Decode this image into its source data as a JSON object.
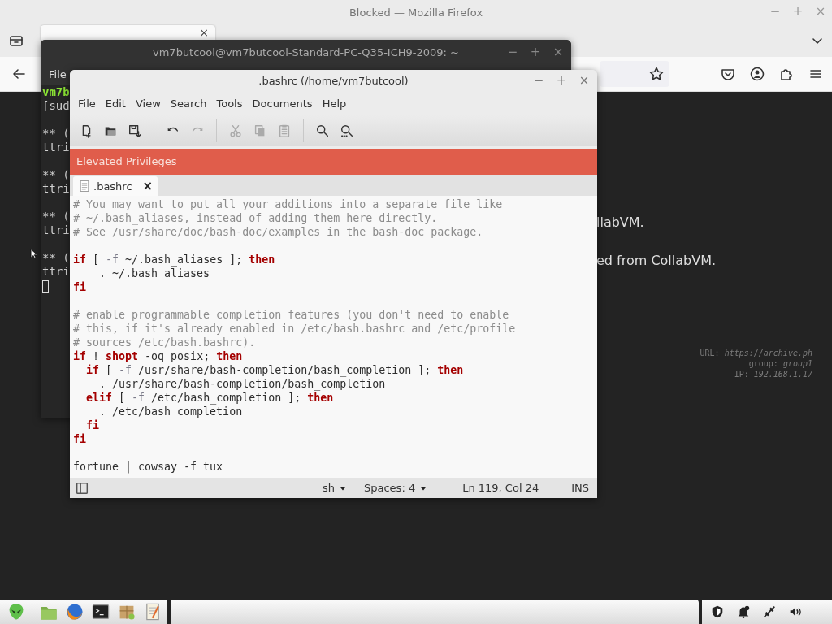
{
  "firefox": {
    "title": "Blocked — Mozilla Firefox",
    "window_controls": [
      "−",
      "+",
      "×"
    ],
    "tab": {
      "close": "×",
      "selected": true
    },
    "page_lines": [
      "llabVM.",
      "ed from CollabVM."
    ],
    "info_lines": [
      "URL: *https://archive.ph*",
      "group: *group1*",
      "IP: *192.168.1.17*"
    ]
  },
  "terminal": {
    "title": "vm7butcool@vm7butcool-Standard-PC-Q35-ICH9-2009: ~",
    "window_controls": [
      "−",
      "+",
      "×"
    ],
    "menu": [
      "File"
    ],
    "lines": [
      {
        "kind": "prompt",
        "text": "vm7b"
      },
      {
        "kind": "text",
        "text": "[sud"
      },
      {
        "kind": "blank"
      },
      {
        "kind": "text",
        "text": "** ("
      },
      {
        "kind": "text",
        "text": "ttri"
      },
      {
        "kind": "blank"
      },
      {
        "kind": "text",
        "text": "** ("
      },
      {
        "kind": "text",
        "text": "ttri"
      },
      {
        "kind": "blank"
      },
      {
        "kind": "text",
        "text": "** ("
      },
      {
        "kind": "text",
        "text": "ttri"
      },
      {
        "kind": "blank"
      },
      {
        "kind": "text",
        "text": "** ("
      },
      {
        "kind": "text",
        "text": "ttri"
      },
      {
        "kind": "cursor"
      }
    ]
  },
  "editor": {
    "title": ".bashrc (/home/vm7butcool)",
    "window_controls": [
      "−",
      "+",
      "×"
    ],
    "menu": [
      "File",
      "Edit",
      "View",
      "Search",
      "Tools",
      "Documents",
      "Help"
    ],
    "toolbar": [
      {
        "kind": "new",
        "disabled": false
      },
      {
        "kind": "open",
        "disabled": false
      },
      {
        "kind": "save",
        "disabled": false
      },
      {
        "kind": "separator"
      },
      {
        "kind": "undo",
        "disabled": false
      },
      {
        "kind": "redo",
        "disabled": true
      },
      {
        "kind": "separator"
      },
      {
        "kind": "cut",
        "disabled": true
      },
      {
        "kind": "copy",
        "disabled": true
      },
      {
        "kind": "paste",
        "disabled": true
      },
      {
        "kind": "separator"
      },
      {
        "kind": "find",
        "disabled": false
      },
      {
        "kind": "replace",
        "disabled": false
      }
    ],
    "banner": "Elevated Privileges",
    "tabs": [
      {
        "label": ".bashrc",
        "close": "×",
        "selected": true
      }
    ],
    "lines": [
      {
        "kind": "code",
        "segments": [
          {
            "kind": "comment",
            "text": "# You may want to put all your additions into a separate file like"
          }
        ]
      },
      {
        "kind": "code",
        "segments": [
          {
            "kind": "comment",
            "text": "# ~/.bash_aliases, instead of adding them here directly."
          }
        ]
      },
      {
        "kind": "code",
        "segments": [
          {
            "kind": "comment",
            "text": "# See /usr/share/doc/bash-doc/examples in the bash-doc package."
          }
        ]
      },
      {
        "kind": "blank"
      },
      {
        "kind": "code",
        "segments": [
          {
            "kind": "keyword",
            "text": "if"
          },
          {
            "kind": "plain",
            "text": " [ "
          },
          {
            "kind": "option",
            "text": "-f"
          },
          {
            "kind": "plain",
            "text": " ~/.bash_aliases ]; "
          },
          {
            "kind": "keyword",
            "text": "then"
          }
        ]
      },
      {
        "kind": "code",
        "segments": [
          {
            "kind": "plain",
            "text": "    . ~/.bash_aliases"
          }
        ]
      },
      {
        "kind": "code",
        "segments": [
          {
            "kind": "keyword",
            "text": "fi"
          }
        ]
      },
      {
        "kind": "blank"
      },
      {
        "kind": "code",
        "segments": [
          {
            "kind": "comment",
            "text": "# enable programmable completion features (you don't need to enable"
          }
        ]
      },
      {
        "kind": "code",
        "segments": [
          {
            "kind": "comment",
            "text": "# this, if it's already enabled in /etc/bash.bashrc and /etc/profile"
          }
        ]
      },
      {
        "kind": "code",
        "segments": [
          {
            "kind": "comment",
            "text": "# sources /etc/bash.bashrc)."
          }
        ]
      },
      {
        "kind": "code",
        "segments": [
          {
            "kind": "keyword",
            "text": "if"
          },
          {
            "kind": "plain",
            "text": " ! "
          },
          {
            "kind": "keyword",
            "text": "shopt"
          },
          {
            "kind": "plain",
            "text": " -oq posix; "
          },
          {
            "kind": "keyword",
            "text": "then"
          }
        ]
      },
      {
        "kind": "code",
        "segments": [
          {
            "kind": "keyword",
            "text": "  if"
          },
          {
            "kind": "plain",
            "text": " [ "
          },
          {
            "kind": "option",
            "text": "-f"
          },
          {
            "kind": "plain",
            "text": " /usr/share/bash-completion/bash_completion ]; "
          },
          {
            "kind": "keyword",
            "text": "then"
          }
        ]
      },
      {
        "kind": "code",
        "segments": [
          {
            "kind": "plain",
            "text": "    . /usr/share/bash-completion/bash_completion"
          }
        ]
      },
      {
        "kind": "code",
        "segments": [
          {
            "kind": "keyword",
            "text": "  elif"
          },
          {
            "kind": "plain",
            "text": " [ "
          },
          {
            "kind": "option",
            "text": "-f"
          },
          {
            "kind": "plain",
            "text": " /etc/bash_completion ]; "
          },
          {
            "kind": "keyword",
            "text": "then"
          }
        ]
      },
      {
        "kind": "code",
        "segments": [
          {
            "kind": "plain",
            "text": "    . /etc/bash_completion"
          }
        ]
      },
      {
        "kind": "code",
        "segments": [
          {
            "kind": "keyword",
            "text": "  fi"
          }
        ]
      },
      {
        "kind": "code",
        "segments": [
          {
            "kind": "keyword",
            "text": "fi"
          }
        ]
      },
      {
        "kind": "blank"
      },
      {
        "kind": "code",
        "segments": [
          {
            "kind": "plain",
            "text": "fortune | cowsay -f tux"
          }
        ]
      }
    ],
    "status": {
      "language": "sh",
      "indent": "Spaces: 4",
      "position": "Ln 119, Col 24",
      "mode": "INS"
    }
  },
  "taskbar": {
    "launchers": [
      {
        "kind": "alien"
      },
      {
        "kind": "folder"
      },
      {
        "kind": "browser"
      },
      {
        "kind": "terminal"
      },
      {
        "kind": "package"
      },
      {
        "kind": "editor"
      }
    ],
    "tray": [
      {
        "kind": "shield"
      },
      {
        "kind": "bell"
      },
      {
        "kind": "network"
      },
      {
        "kind": "volume"
      }
    ]
  }
}
